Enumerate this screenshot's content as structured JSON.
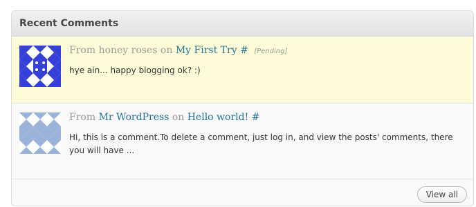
{
  "widget": {
    "title": "Recent Comments"
  },
  "comments": [
    {
      "from_label": "From",
      "author": "honey roses",
      "on_label": "on",
      "post": "My First Try",
      "hash": "#",
      "status": "[Pending]",
      "text": "hye ain... happy blogging ok? :)",
      "avatar_icon": "identicon-avatar",
      "avatar_color": "#3440d6"
    },
    {
      "from_label": "From",
      "author": "Mr WordPress",
      "on_label": "on",
      "post": "Hello world!",
      "hash": "#",
      "text": "Hi, this is a comment.To delete a comment, just log in, and view the posts' comments, there you will have ...",
      "avatar_icon": "identicon-avatar",
      "avatar_color": "#9bb3d8"
    }
  ],
  "footer": {
    "view_all_label": "View all"
  },
  "colors": {
    "pending_bg": "#fefcd8",
    "link": "#21759b"
  }
}
